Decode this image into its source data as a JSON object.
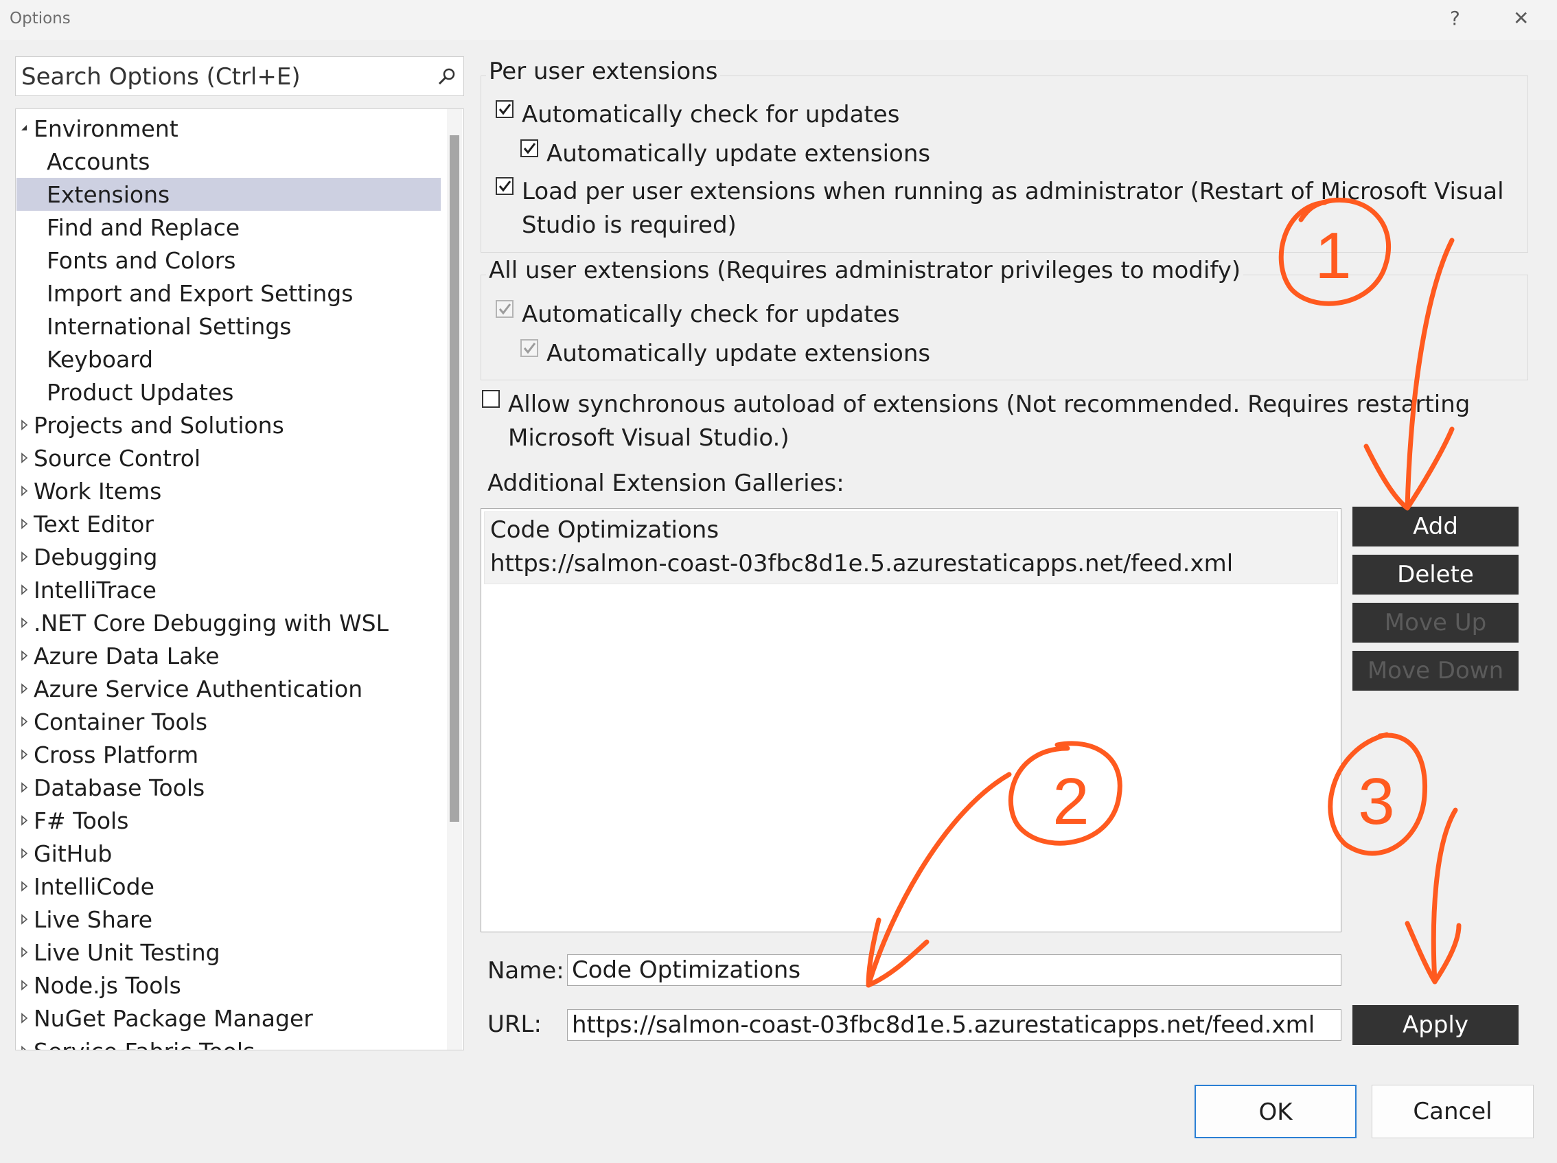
{
  "window": {
    "title": "Options",
    "help": "?",
    "close": "✕"
  },
  "search": {
    "placeholder": "Search Options (Ctrl+E)"
  },
  "tree": {
    "items": [
      {
        "label": "Environment",
        "expanded": true
      },
      {
        "label": "Accounts"
      },
      {
        "label": "Extensions",
        "selected": true
      },
      {
        "label": "Find and Replace"
      },
      {
        "label": "Fonts and Colors"
      },
      {
        "label": "Import and Export Settings"
      },
      {
        "label": "International Settings"
      },
      {
        "label": "Keyboard"
      },
      {
        "label": "Product Updates"
      },
      {
        "label": "Projects and Solutions"
      },
      {
        "label": "Source Control"
      },
      {
        "label": "Work Items"
      },
      {
        "label": "Text Editor"
      },
      {
        "label": "Debugging"
      },
      {
        "label": "IntelliTrace"
      },
      {
        "label": ".NET Core Debugging with WSL"
      },
      {
        "label": "Azure Data Lake"
      },
      {
        "label": "Azure Service Authentication"
      },
      {
        "label": "Container Tools"
      },
      {
        "label": "Cross Platform"
      },
      {
        "label": "Database Tools"
      },
      {
        "label": "F# Tools"
      },
      {
        "label": "GitHub"
      },
      {
        "label": "IntelliCode"
      },
      {
        "label": "Live Share"
      },
      {
        "label": "Live Unit Testing"
      },
      {
        "label": "Node.js Tools"
      },
      {
        "label": "NuGet Package Manager"
      },
      {
        "label": "Service Fabric Tools"
      }
    ]
  },
  "per_user": {
    "title": "Per user extensions",
    "auto_check": {
      "label": "Automatically check for updates",
      "checked": true
    },
    "auto_update": {
      "label": "Automatically update extensions",
      "checked": true
    },
    "load_admin": {
      "label_line1": "Load per user extensions when running as administrator (Restart of Microsoft Visual",
      "label_line2": "Studio is required)",
      "checked": true
    }
  },
  "all_user": {
    "title": "All user extensions (Requires administrator privileges to modify)",
    "auto_check": {
      "label": "Automatically check for updates",
      "checked": true,
      "disabled": true
    },
    "auto_update": {
      "label": "Automatically update extensions",
      "checked": true,
      "disabled": true
    }
  },
  "sync_autoload": {
    "label_line1": "Allow synchronous autoload of extensions (Not recommended. Requires restarting",
    "label_line2": "Microsoft Visual Studio.)",
    "checked": false
  },
  "galleries": {
    "title": "Additional Extension Galleries:",
    "items": [
      {
        "name": "Code Optimizations",
        "url": "https://salmon-coast-03fbc8d1e.5.azurestaticapps.net/feed.xml"
      }
    ]
  },
  "buttons": {
    "add": "Add",
    "delete": "Delete",
    "move_up": "Move Up",
    "move_down": "Move Down",
    "apply": "Apply",
    "ok": "OK",
    "cancel": "Cancel"
  },
  "form": {
    "name_label": "Name:",
    "name_value": "Code Optimizations",
    "url_label": "URL:",
    "url_value": "https://salmon-coast-03fbc8d1e.5.azurestaticapps.net/feed.xml"
  },
  "annotations": {
    "color": "#ff5a1f",
    "numbers": [
      "1",
      "2",
      "3"
    ]
  }
}
